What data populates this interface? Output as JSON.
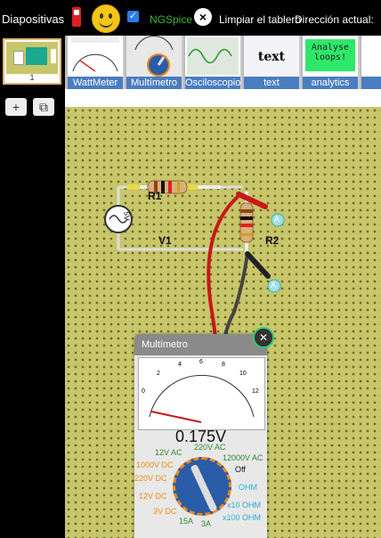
{
  "sidebar": {
    "title": "Diapositivas",
    "slide_number": "1",
    "add_label": "+",
    "copy_label": "⧉"
  },
  "topbar": {
    "simulator_label": "NGSpice",
    "clear_label": "Limpiar el tablero",
    "direction_label": "Dirección actual:",
    "power_color": "#e02020",
    "smiley": "🙂",
    "checkbox_checked": true
  },
  "palette": {
    "items": [
      {
        "label": "WattMeter"
      },
      {
        "label": "Multímetro"
      },
      {
        "label": "Osciloscopio"
      },
      {
        "label": "text",
        "preview": "text"
      },
      {
        "label": "analytics",
        "preview": "Analyse loops!"
      }
    ]
  },
  "circuit": {
    "r1_label": "R1",
    "r2_label": "R2",
    "v1_label": "V1",
    "v1_value": "5V",
    "probe_a1": "A",
    "probe_a2": "A"
  },
  "multimeter": {
    "title": "Multímetro",
    "reading": "0.175V",
    "scale": [
      "0",
      "2",
      "4",
      "6",
      "8",
      "10",
      "12"
    ],
    "selector": {
      "v12ac": "12V AC",
      "v220ac": "220V AC",
      "v12000ac": "12000V AC",
      "off": "Off",
      "v1000dc": "1000V DC",
      "v220dc": "220V DC",
      "v12dc": "12V DC",
      "v3dc": "3V DC",
      "a15": "15A",
      "a3": "3A",
      "ohm": "OHM",
      "x10ohm": "x10 OHM",
      "x100ohm": "x100 OHM"
    }
  }
}
